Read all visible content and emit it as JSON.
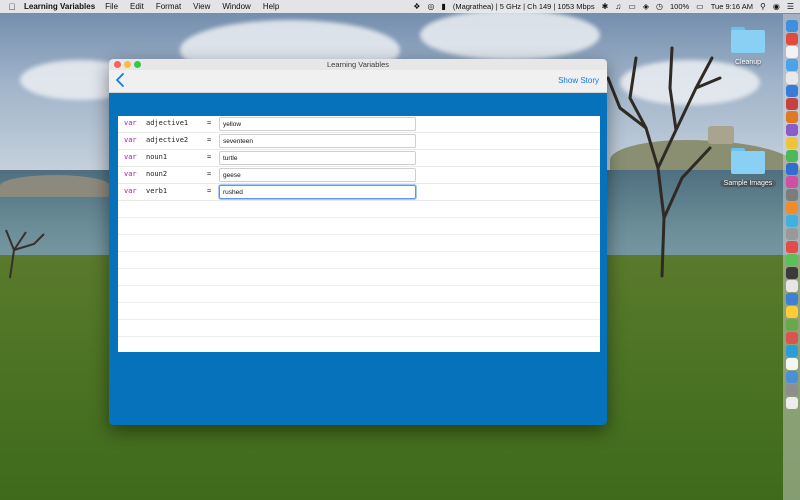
{
  "menubar": {
    "app_name": "Learning Variables",
    "menus": [
      "File",
      "Edit",
      "Format",
      "View",
      "Window",
      "Help"
    ],
    "network": "(Magrathea) | 5 GHz | Ch 149 | 1053 Mbps",
    "battery": "100%",
    "clock": "Tue 9:16 AM"
  },
  "desktop": {
    "folders": [
      {
        "label": "Cleanup"
      },
      {
        "label": "Sample Images"
      }
    ]
  },
  "window": {
    "title": "Learning Variables",
    "nav": {
      "back_icon": "chevron-left-icon",
      "show_story_label": "Show Story"
    },
    "rows": [
      {
        "keyword": "var",
        "name": "adjective1",
        "equals": "=",
        "value": "yellow",
        "focused": false
      },
      {
        "keyword": "var",
        "name": "adjective2",
        "equals": "=",
        "value": "seventeen",
        "focused": false
      },
      {
        "keyword": "var",
        "name": "noun1",
        "equals": "=",
        "value": "turtle",
        "focused": false
      },
      {
        "keyword": "var",
        "name": "noun2",
        "equals": "=",
        "value": "geese",
        "focused": false
      },
      {
        "keyword": "var",
        "name": "verb1",
        "equals": "=",
        "value": "rushed",
        "focused": true
      }
    ],
    "colors": {
      "background": "#0572bb",
      "keyword": "#b0169b",
      "link": "#1478e6"
    }
  }
}
